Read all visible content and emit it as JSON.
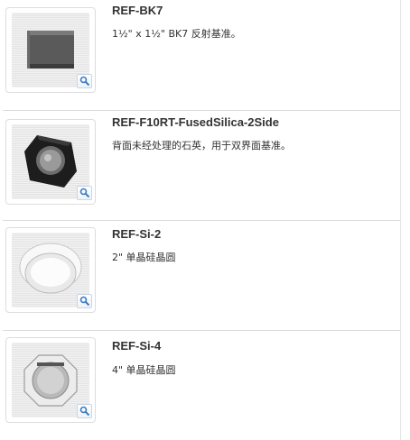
{
  "products": [
    {
      "title": "REF-BK7",
      "description": "1½\" x 1½\" BK7 反射基准。",
      "image": "bk7-square-glass-substrate",
      "zoom_icon": "magnifier-icon"
    },
    {
      "title": "REF-F10RT-FusedSilica-2Side",
      "description": "背面未经处理的石英，用于双界面基准。",
      "image": "fused-silica-in-black-holder",
      "zoom_icon": "magnifier-icon"
    },
    {
      "title": "REF-Si-2",
      "description": "2\" 单晶硅晶圆",
      "image": "2-inch-silicon-wafer-in-case",
      "zoom_icon": "magnifier-icon"
    },
    {
      "title": "REF-Si-4",
      "description": "4\" 单晶硅晶圆",
      "image": "4-inch-silicon-wafer-in-case",
      "zoom_icon": "magnifier-icon"
    }
  ],
  "colors": {
    "text": "#333333",
    "divider": "#dcdcdc",
    "zoom_icon": "#3a7cc4"
  }
}
